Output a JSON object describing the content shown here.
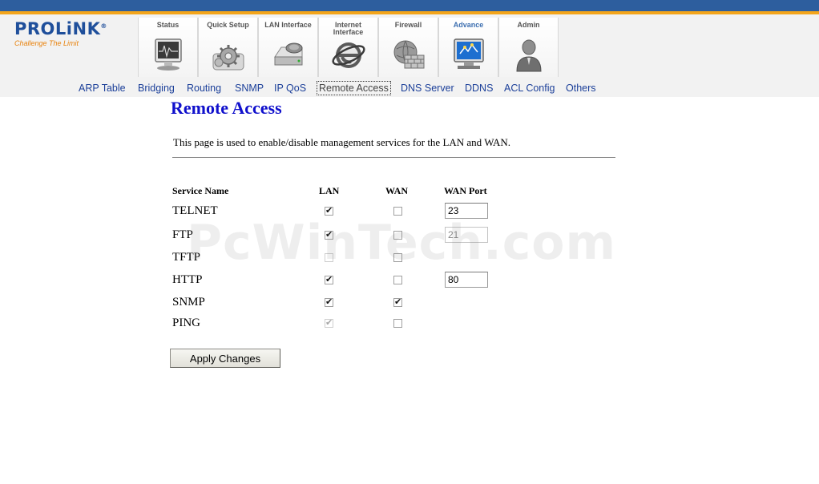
{
  "brand": {
    "name": "PROLiNK",
    "mark": "®",
    "tagline": "Challenge The Limit"
  },
  "colors": {
    "top_bar": "#2d5e9e",
    "accent_bar": "#f3a51b",
    "title": "#1010cc",
    "nav_link": "#1b3f99",
    "active_tab_label": "#3d6fb0"
  },
  "tabs": [
    {
      "label": "Status",
      "icon": "monitor-icon",
      "active": false
    },
    {
      "label": "Quick Setup",
      "icon": "gears-icon",
      "active": false
    },
    {
      "label": "LAN Interface",
      "icon": "network-drive-icon",
      "active": false
    },
    {
      "label": "Internet Interface",
      "icon": "internet-explorer-icon",
      "active": false
    },
    {
      "label": "Firewall",
      "icon": "firewall-globe-icon",
      "active": false
    },
    {
      "label": "Advance",
      "icon": "advanced-monitor-icon",
      "active": true
    },
    {
      "label": "Admin",
      "icon": "admin-user-icon",
      "active": false
    }
  ],
  "subnav": [
    {
      "label": "ARP Table"
    },
    {
      "label": "Bridging"
    },
    {
      "label": "Routing"
    },
    {
      "label": "SNMP"
    },
    {
      "label": "IP QoS"
    },
    {
      "label": "Remote Access",
      "active": true
    },
    {
      "label": "DNS Server"
    },
    {
      "label": "DDNS"
    },
    {
      "label": "ACL Config"
    },
    {
      "label": "Others"
    }
  ],
  "page": {
    "title": "Remote Access",
    "description": "This page is used to enable/disable management services for the LAN and WAN."
  },
  "table": {
    "headers": {
      "service": "Service Name",
      "lan": "LAN",
      "wan": "WAN",
      "port": "WAN Port"
    },
    "rows": [
      {
        "name": "TELNET",
        "lan": true,
        "lan_disabled": false,
        "wan": false,
        "wan_disabled": false,
        "port": "23",
        "port_disabled": false
      },
      {
        "name": "FTP",
        "lan": true,
        "lan_disabled": false,
        "wan": false,
        "wan_disabled": false,
        "port": "21",
        "port_disabled": true
      },
      {
        "name": "TFTP",
        "lan": false,
        "lan_disabled": true,
        "wan": false,
        "wan_disabled": false,
        "port": null
      },
      {
        "name": "HTTP",
        "lan": true,
        "lan_disabled": false,
        "wan": false,
        "wan_disabled": false,
        "port": "80",
        "port_disabled": false
      },
      {
        "name": "SNMP",
        "lan": true,
        "lan_disabled": false,
        "wan": true,
        "wan_disabled": false,
        "port": null
      },
      {
        "name": "PING",
        "lan": true,
        "lan_disabled": true,
        "wan": false,
        "wan_disabled": false,
        "port": null
      }
    ]
  },
  "apply_label": "Apply Changes",
  "watermark": "PcWinTech.com"
}
